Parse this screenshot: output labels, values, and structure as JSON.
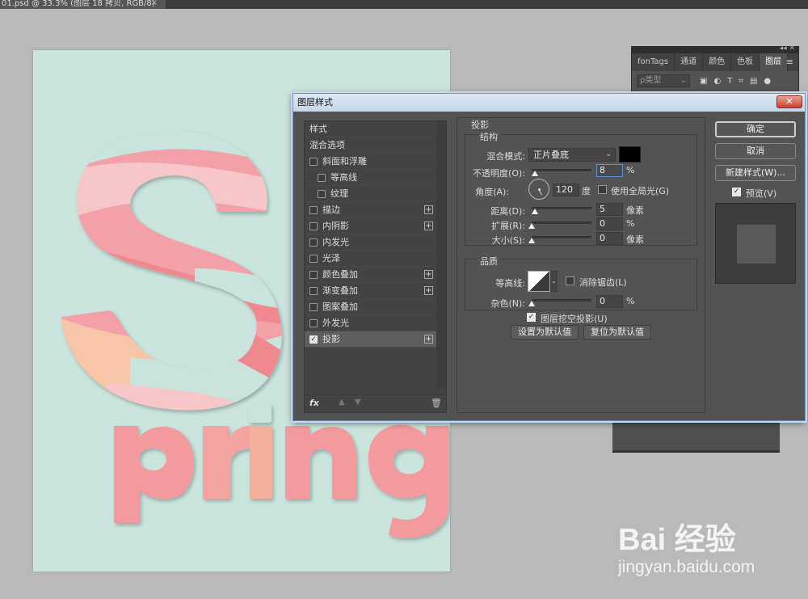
{
  "document": {
    "tab_title": "01.psd @ 33.3% (图层 18 拷贝, RGB/8)",
    "close_glyph": "×"
  },
  "canvas": {
    "background": "#cbe5de",
    "big_letter": "S",
    "word": "pring"
  },
  "layers_panel": {
    "collapse_glyph": "◂◂ ✕",
    "tabs": [
      "fonTags",
      "通道",
      "颜色",
      "色板",
      "图层"
    ],
    "active_tab": "图层",
    "kind_filter": "ρ类型",
    "menu_glyph": "≡"
  },
  "dialog": {
    "title": "图层样式",
    "close_glyph": "✕",
    "style_list": [
      {
        "label": "样式",
        "checkbox": false,
        "plus": false,
        "indent": 0
      },
      {
        "label": "混合选项",
        "checkbox": false,
        "plus": false,
        "indent": 0
      },
      {
        "label": "斜面和浮雕",
        "checkbox": true,
        "checked": false,
        "plus": false,
        "indent": 0
      },
      {
        "label": "等高线",
        "checkbox": true,
        "checked": false,
        "plus": false,
        "indent": 1
      },
      {
        "label": "纹理",
        "checkbox": true,
        "checked": false,
        "plus": false,
        "indent": 1
      },
      {
        "label": "描边",
        "checkbox": true,
        "checked": false,
        "plus": true,
        "indent": 0
      },
      {
        "label": "内阴影",
        "checkbox": true,
        "checked": false,
        "plus": true,
        "indent": 0
      },
      {
        "label": "内发光",
        "checkbox": true,
        "checked": false,
        "plus": false,
        "indent": 0
      },
      {
        "label": "光泽",
        "checkbox": true,
        "checked": false,
        "plus": false,
        "indent": 0
      },
      {
        "label": "颜色叠加",
        "checkbox": true,
        "checked": false,
        "plus": true,
        "indent": 0
      },
      {
        "label": "渐变叠加",
        "checkbox": true,
        "checked": false,
        "plus": true,
        "indent": 0
      },
      {
        "label": "图案叠加",
        "checkbox": true,
        "checked": false,
        "plus": false,
        "indent": 0
      },
      {
        "label": "外发光",
        "checkbox": true,
        "checked": false,
        "plus": false,
        "indent": 0
      },
      {
        "label": "投影",
        "checkbox": true,
        "checked": true,
        "plus": true,
        "indent": 0,
        "selected": true
      }
    ],
    "footer": {
      "fx": "fx",
      "up": "▲",
      "down": "▼",
      "trash": "🗑"
    },
    "drop_shadow": {
      "section_title": "投影",
      "structure_title": "结构",
      "blend_mode_label": "混合模式:",
      "blend_mode_value": "正片叠底",
      "shadow_color": "#000000",
      "opacity_label": "不透明度(O):",
      "opacity_value": "8",
      "opacity_unit": "%",
      "angle_label": "角度(A):",
      "angle_value": "120",
      "angle_unit": "度",
      "global_light_label": "使用全局光(G)",
      "global_light_checked": false,
      "distance_label": "距离(D):",
      "distance_value": "5",
      "distance_unit": "像素",
      "spread_label": "扩展(R):",
      "spread_value": "0",
      "spread_unit": "%",
      "size_label": "大小(S):",
      "size_value": "0",
      "size_unit": "像素",
      "quality_title": "品质",
      "contour_label": "等高线:",
      "antialias_label": "消除锯齿(L)",
      "antialias_checked": false,
      "noise_label": "杂色(N):",
      "noise_value": "0",
      "noise_unit": "%",
      "knockout_label": "图层挖空投影(U)",
      "knockout_checked": true,
      "set_default_label": "设置为默认值",
      "reset_default_label": "复位为默认值"
    },
    "buttons": {
      "ok": "确定",
      "cancel": "取消",
      "new_style": "新建样式(W)...",
      "preview_label": "预览(V)",
      "preview_checked": true
    }
  },
  "watermark": {
    "logo": "Bai 经验",
    "url": "jingyan.baidu.com"
  }
}
